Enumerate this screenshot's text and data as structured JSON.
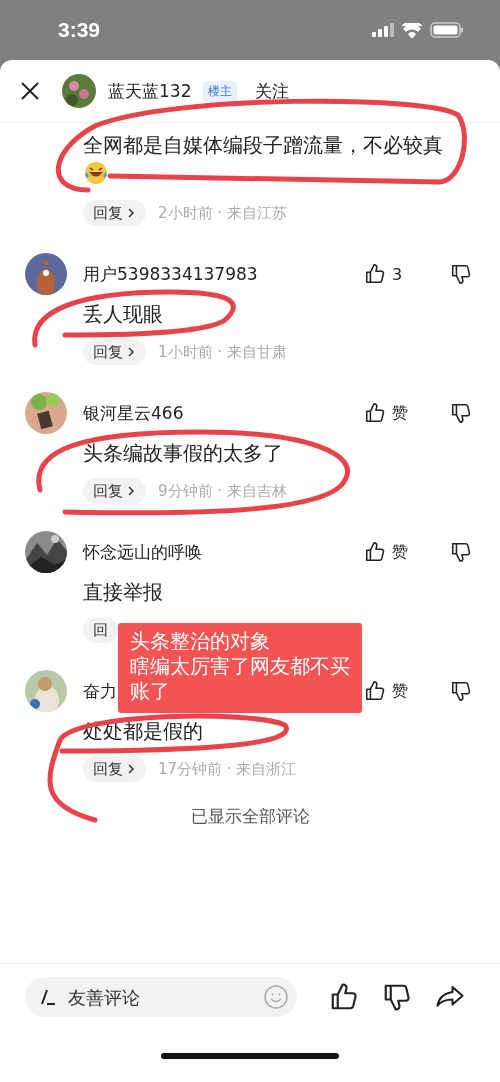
{
  "status_bar": {
    "time": "3:39"
  },
  "header": {
    "author": "蓝天蓝132",
    "badge": "楼主",
    "follow": "关注"
  },
  "comments": [
    {
      "kind": "main",
      "text": "全网都是自媒体编段子蹭流量，不必较真",
      "emoji": true,
      "reply": "回复",
      "chevron": true,
      "meta": "2小时前 · 来自江苏"
    },
    {
      "kind": "reply",
      "name": "用户5398334137983",
      "likes": "3",
      "text": "丢人现眼",
      "emoji": false,
      "reply": "回复",
      "chevron": true,
      "meta": "1小时前 · 来自甘肃"
    },
    {
      "kind": "reply",
      "name": "银河星云466",
      "likes": "赞",
      "text": "头条编故事假的太多了",
      "emoji": false,
      "reply": "回复",
      "chevron": true,
      "meta": "9分钟前 · 来自吉林"
    },
    {
      "kind": "reply",
      "name": "怀念远山的呼唤",
      "likes": "赞",
      "text": "直接举报",
      "emoji": false,
      "reply": "回",
      "chevron": false
    },
    {
      "kind": "reply",
      "name": "奋力",
      "likes": "赞",
      "text": "处处都是假的",
      "emoji": false,
      "reply": "回复",
      "chevron": true,
      "meta": "17分钟前 · 来自浙江"
    }
  ],
  "end_note": "已显示全部评论",
  "annotation": {
    "lines": [
      "头条整治的对象",
      "瞎编太厉害了网友都不买账了"
    ]
  },
  "bottom_bar": {
    "placeholder": "友善评论"
  }
}
